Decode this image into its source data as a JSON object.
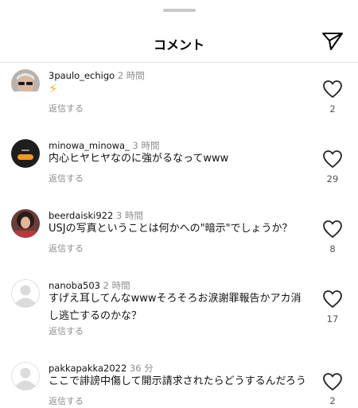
{
  "header": {
    "title": "コメント",
    "share_icon": "send-icon"
  },
  "comments": [
    {
      "username": "3paulo_echigo",
      "time": "2 時間",
      "text": "⚡",
      "reply": "返信する",
      "likes": "2",
      "avatar": "photo-man-sunglasses"
    },
    {
      "username": "minowa_minowa_",
      "time": "3 時間",
      "text": "内心ヒヤヒヤなのに強がるなってwww",
      "reply": "返信する",
      "likes": "29",
      "avatar": "dark-badge"
    },
    {
      "username": "beerdaiski922",
      "time": "3 時間",
      "text": "USJの写真ということは何かへの\"暗示\"でしょうか？",
      "reply": "返信する",
      "likes": "8",
      "avatar": "photo-woman"
    },
    {
      "username": "nanoba503",
      "time": "2 時間",
      "text": "すげえ耳してんなwwwそろそろお涙謝罪報告かアカ消し逃亡するのかな？",
      "reply": "返信する",
      "likes": "17",
      "avatar": "default"
    },
    {
      "username": "pakkapakka2022",
      "time": "36 分",
      "text": "ここで誹謗中傷して開示請求されたらどうするんだろう",
      "reply": "返信する",
      "likes": "2",
      "avatar": "default"
    }
  ]
}
